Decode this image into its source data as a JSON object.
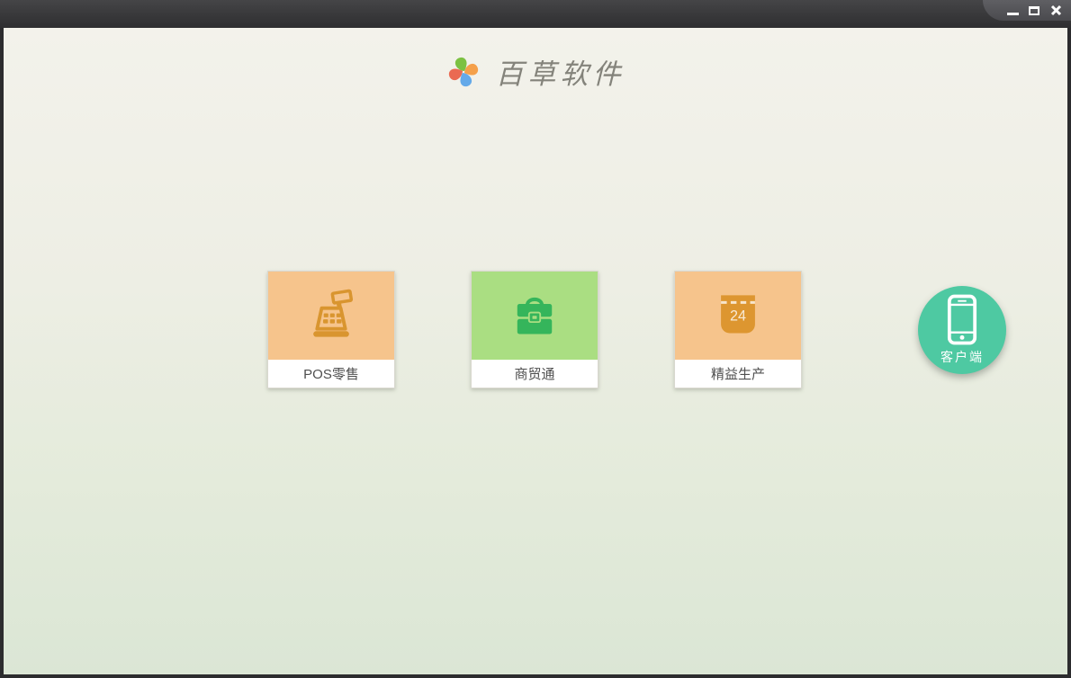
{
  "window": {
    "controls": [
      {
        "name": "minimize",
        "icon": "minimize-icon"
      },
      {
        "name": "maximize",
        "icon": "maximize-icon"
      },
      {
        "name": "close",
        "icon": "close-icon"
      }
    ]
  },
  "header": {
    "app_title": "百草软件",
    "logo_icon": "pinwheel-logo-icon",
    "logo_colors": {
      "top": "#7cc142",
      "right": "#f5a04a",
      "bottom": "#64a9e9",
      "left": "#ea6a52"
    }
  },
  "products": [
    {
      "label": "POS零售",
      "icon": "cash-register-icon",
      "tile_color": "#f6c48c",
      "icon_color": "#d9952f"
    },
    {
      "label": "商贸通",
      "icon": "briefcase-icon",
      "tile_color": "#aade82",
      "icon_color": "#35b55b"
    },
    {
      "label": "精益生产",
      "icon": "calendar-icon",
      "calendar_day": "24",
      "tile_color": "#f6c48c",
      "icon_color": "#dd9630"
    }
  ],
  "client": {
    "label": "客户端",
    "icon": "smartphone-icon",
    "color": "#4ec9a2"
  },
  "colors": {
    "titlebar": "#3a3a3c",
    "background_top": "#f3f2eb",
    "background_bottom": "#dbe6d5",
    "card_label_text": "#4f4f4f",
    "title_text": "#84837b"
  }
}
